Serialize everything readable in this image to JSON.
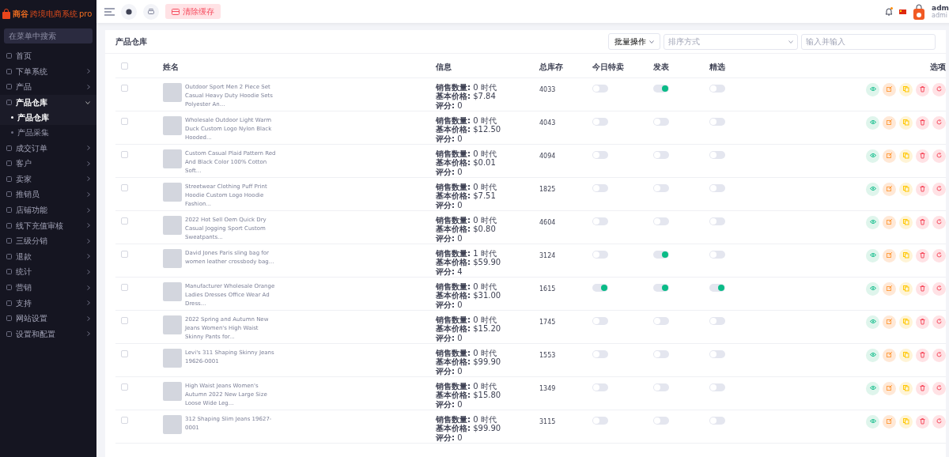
{
  "brand": {
    "name": "商谷",
    "subtitle": "跨境电商系统",
    "edition": "pro"
  },
  "sidebar": {
    "search": {
      "placeholder": "在菜单中搜索"
    },
    "items": [
      {
        "label": "首页"
      },
      {
        "label": "下单系统",
        "expanded": false
      },
      {
        "label": "产品",
        "expanded": false
      },
      {
        "label": "产品仓库",
        "expanded": true,
        "children": [
          {
            "label": "产品仓库",
            "selected": true
          },
          {
            "label": "产品采集",
            "selected": false
          }
        ]
      },
      {
        "label": "成交订单",
        "expanded": false
      },
      {
        "label": "客户",
        "expanded": false
      },
      {
        "label": "卖家",
        "expanded": false
      },
      {
        "label": "推销员",
        "expanded": false
      },
      {
        "label": "店铺功能",
        "expanded": false
      },
      {
        "label": "线下充值审核",
        "expanded": false
      },
      {
        "label": "三级分销",
        "expanded": false
      },
      {
        "label": "退款",
        "expanded": false
      },
      {
        "label": "统计",
        "expanded": false
      },
      {
        "label": "营销",
        "expanded": false
      },
      {
        "label": "支持",
        "expanded": false
      },
      {
        "label": "网站设置",
        "expanded": false
      },
      {
        "label": "设置和配置",
        "expanded": false
      }
    ]
  },
  "topbar": {
    "clear_cache": "清除缓存",
    "user": {
      "name": "adm",
      "role": "admi"
    },
    "notification": true
  },
  "page": {
    "title": "产品仓库",
    "bulk_action": "批量操作",
    "sort": {
      "placeholder": "排序方式"
    },
    "search": {
      "placeholder": "输入并输入"
    }
  },
  "table": {
    "select_all": false,
    "columns": [
      "姓名",
      "信息",
      "总库存",
      "今日特卖",
      "发表",
      "精选",
      "选项"
    ],
    "rows": [
      {
        "checked": false,
        "name": "Outdoor Sport Men 2 Piece Set Casual Heavy Duty Hoodie Sets Polyester An...",
        "info": [
          "**销售数量:** 0 时代",
          "**基本价格:** $7.84",
          "**评分:** 0"
        ],
        "stock": "4033",
        "todays_deal": false,
        "published": true,
        "featured": false
      },
      {
        "checked": false,
        "name": "Wholesale Outdoor Light Warm Duck Custom Logo Nylon Black Hooded...",
        "info": [
          "**销售数量:** 0 时代",
          "**基本价格:** $12.50",
          "**评分:** 0"
        ],
        "stock": "4043",
        "todays_deal": false,
        "published": false,
        "featured": false
      },
      {
        "checked": false,
        "name": "Custom Casual Plaid Pattern Red And Black Color 100% Cotton Soft...",
        "info": [
          "**销售数量:** 0 时代",
          "**基本价格:** $0.01",
          "**评分:** 0"
        ],
        "stock": "4094",
        "todays_deal": false,
        "published": false,
        "featured": false
      },
      {
        "checked": false,
        "name": "Streetwear Clothing Puff Print Hoodie Custom Logo Hoodie Fashion...",
        "info": [
          "**销售数量:** 0 时代",
          "**基本价格:** $7.51",
          "**评分:** 0"
        ],
        "stock": "1825",
        "todays_deal": false,
        "published": false,
        "featured": false
      },
      {
        "checked": false,
        "name": "2022 Hot Sell Oem Quick Dry Casual Jogging Sport Custom Sweatpants...",
        "info": [
          "**销售数量:** 0 时代",
          "**基本价格:** $0.80",
          "**评分:** 0"
        ],
        "stock": "4604",
        "todays_deal": false,
        "published": false,
        "featured": false
      },
      {
        "checked": false,
        "name": "David Jones Paris sling bag for women leather crossbody bag...",
        "info": [
          "**销售数量:** 1 时代",
          "**基本价格:** $59.90",
          "**评分:** 4"
        ],
        "stock": "3124",
        "todays_deal": false,
        "published": true,
        "featured": false
      },
      {
        "checked": false,
        "name": "Manufacturer Wholesale Orange Ladies Dresses Office Wear Ad Dress...",
        "info": [
          "**销售数量:** 0 时代",
          "**基本价格:** $31.00",
          "**评分:** 0"
        ],
        "stock": "1615",
        "todays_deal": true,
        "published": true,
        "featured": true
      },
      {
        "checked": false,
        "name": "2022 Spring and Autumn New Jeans Women's High Waist Skinny Pants for...",
        "info": [
          "**销售数量:** 0 时代",
          "**基本价格:** $15.20",
          "**评分:** 0"
        ],
        "stock": "1745",
        "todays_deal": false,
        "published": false,
        "featured": false
      },
      {
        "checked": false,
        "name": "Levi's 311 Shaping Skinny Jeans 19626-0001",
        "info": [
          "**销售数量:** 0 时代",
          "**基本价格:** $99.90",
          "**评分:** 0"
        ],
        "stock": "1553",
        "todays_deal": false,
        "published": false,
        "featured": false
      },
      {
        "checked": false,
        "name": "High Waist Jeans Women's Autumn 2022 New Large Size Loose Wide Leg...",
        "info": [
          "**销售数量:** 0 时代",
          "**基本价格:** $15.80",
          "**评分:** 0"
        ],
        "stock": "1349",
        "todays_deal": false,
        "published": false,
        "featured": false
      },
      {
        "checked": false,
        "name": "312 Shaping Slim Jeans 19627-0001",
        "info": [
          "**销售数量:** 0 时代",
          "**基本价格:** $99.90",
          "**评分:** 0"
        ],
        "stock": "3115",
        "todays_deal": false,
        "published": false,
        "featured": false
      }
    ]
  }
}
